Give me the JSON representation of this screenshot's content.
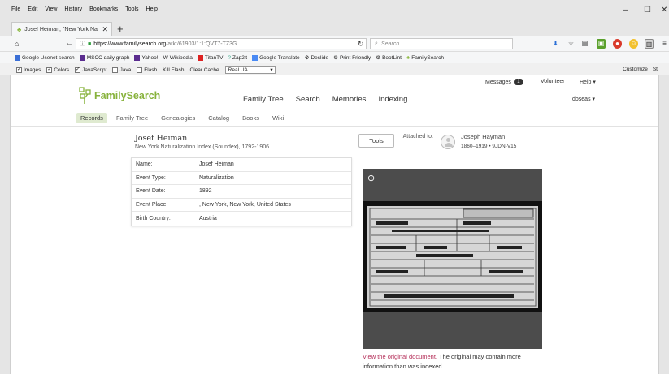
{
  "browser": {
    "menu": [
      "File",
      "Edit",
      "View",
      "History",
      "Bookmarks",
      "Tools",
      "Help"
    ],
    "window_controls": {
      "minimize": "–",
      "maximize": "☐",
      "close": "✕"
    },
    "tab": {
      "title": "Josef Heiman, \"New York Na",
      "close": "✕"
    },
    "new_tab": "+",
    "url": {
      "host": "https://www.familysearch.org",
      "path": "/ark:/61903/1:1:QVT7-TZ3G"
    },
    "search_placeholder": "Search",
    "bookmarks": [
      "Google Usenet search",
      "MSCC daily graph",
      "Yahoo!",
      "Wikipedia",
      "TitanTV",
      "Zap2it",
      "Google Translate",
      "Deslide",
      "Print Friendly",
      "BootLint",
      "FamilySearch"
    ],
    "devbar": {
      "checks": [
        {
          "label": "Images",
          "checked": true
        },
        {
          "label": "Colors",
          "checked": true
        },
        {
          "label": "JavaScript",
          "checked": true
        },
        {
          "label": "Java",
          "checked": false
        },
        {
          "label": "Flash",
          "checked": false
        }
      ],
      "kill_flash": "Kill Flash",
      "clear_cache": "Clear Cache",
      "ua_value": "Real UA",
      "customize": "Customize",
      "edge": "St"
    }
  },
  "site": {
    "logo_text": "FamilySearch",
    "messages_label": "Messages",
    "messages_count": "1",
    "volunteer": "Volunteer",
    "help": "Help ▾",
    "user": "doseas ▾",
    "main_nav": [
      "Family Tree",
      "Search",
      "Memories",
      "Indexing"
    ],
    "sub_nav": [
      "Records",
      "Family Tree",
      "Genealogies",
      "Catalog",
      "Books",
      "Wiki"
    ]
  },
  "record": {
    "name": "Josef Heiman",
    "collection": "New York Naturalization Index (Soundex), 1792-1906",
    "rows": [
      {
        "label": "Name:",
        "value": "Josef Heiman"
      },
      {
        "label": "Event Type:",
        "value": "Naturalization"
      },
      {
        "label": "Event Date:",
        "value": "1892"
      },
      {
        "label": "Event Place:",
        "value": ", New York, New York, United States"
      },
      {
        "label": "Birth Country:",
        "value": "Austria"
      }
    ]
  },
  "attachment": {
    "tools": "Tools",
    "attached_label": "Attached to:",
    "person_name": "Joseph Hayman",
    "person_meta": "1860–1919 • 9JDN-V15"
  },
  "image_note": {
    "link": "View the original document.",
    "text": " The original may contain more information than was indexed."
  },
  "colors": {
    "brand_green": "#87b23b",
    "link": "#b5305a",
    "active_subnav": "#dfead0"
  }
}
